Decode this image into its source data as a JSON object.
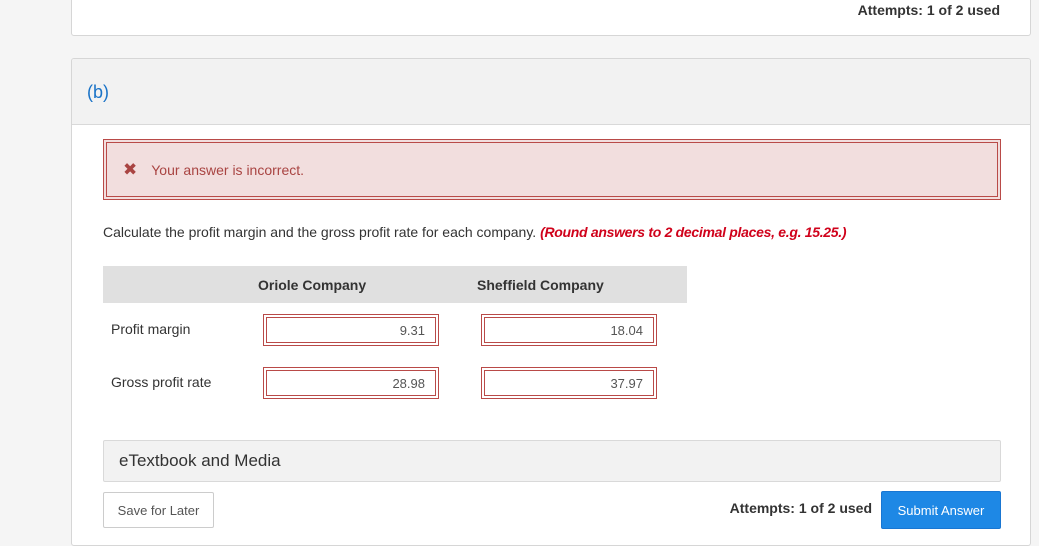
{
  "top": {
    "attempts": "Attempts: 1 of 2 used"
  },
  "part": {
    "label": "(b)",
    "alert": {
      "icon": "x-icon",
      "text": "Your answer is incorrect."
    },
    "question": {
      "text": "Calculate the profit margin and the gross profit rate for each company. ",
      "instruction": "(Round answers to 2 decimal places, e.g. 15.25.)"
    },
    "table": {
      "columns": [
        "Oriole Company",
        "Sheffield Company"
      ],
      "rows": [
        {
          "label": "Profit margin",
          "values": [
            "9.31",
            "18.04"
          ]
        },
        {
          "label": "Gross profit rate",
          "values": [
            "28.98",
            "37.97"
          ]
        }
      ]
    },
    "etextbook": "eTextbook and Media",
    "save_label": "Save for Later",
    "attempts": "Attempts: 1 of 2 used",
    "submit_label": "Submit Answer"
  },
  "colors": {
    "link": "#1a73c7",
    "error": "#a94442",
    "instruction": "#d0021b",
    "submit": "#1e88e5"
  }
}
